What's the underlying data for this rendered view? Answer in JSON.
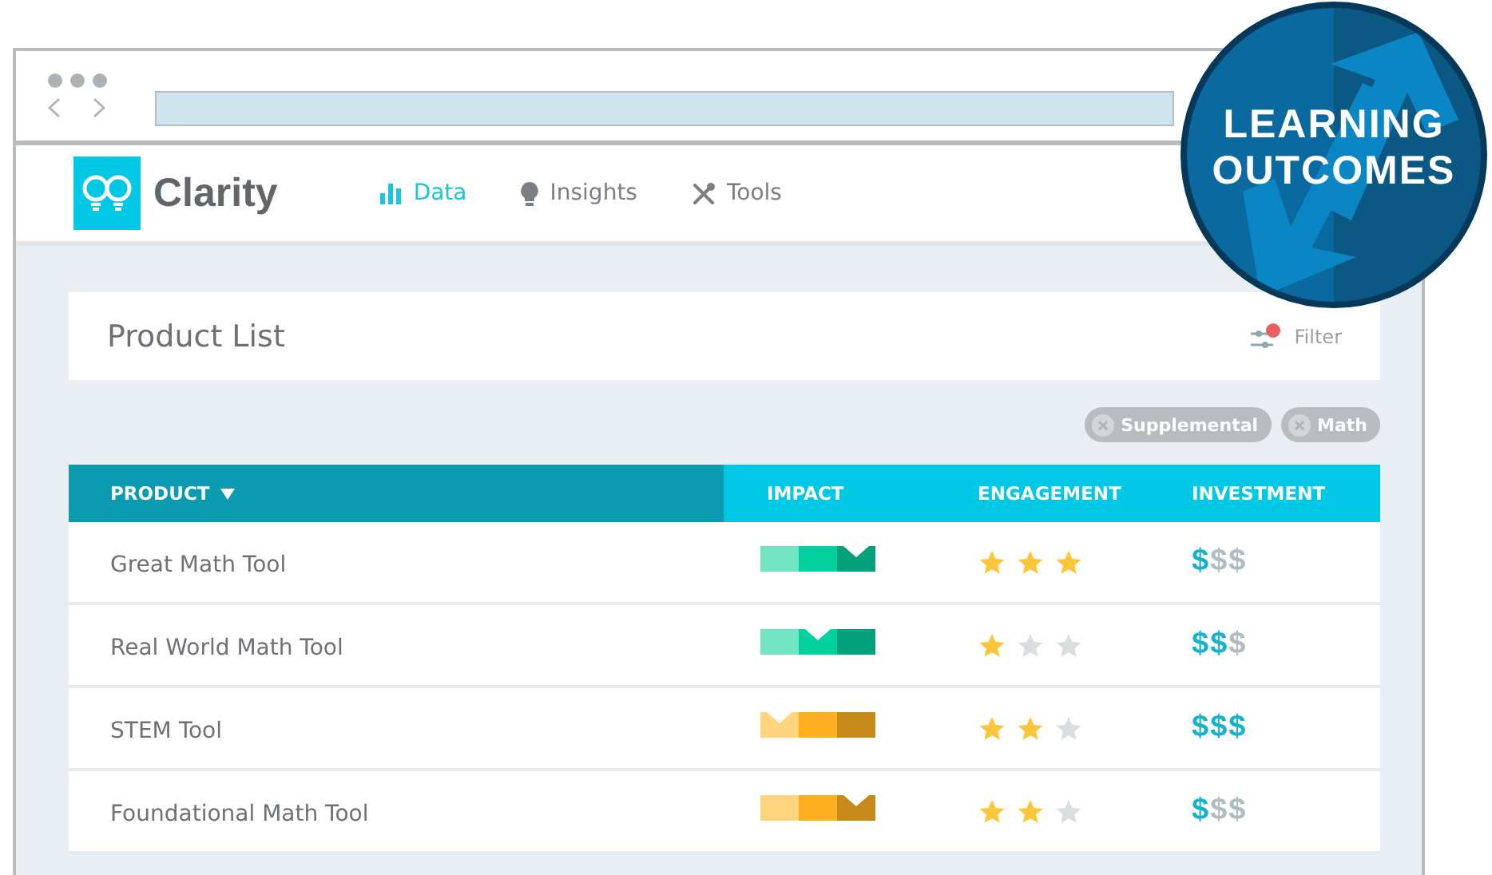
{
  "app": {
    "name": "Clarity"
  },
  "nav": [
    {
      "label": "Data",
      "selected": true
    },
    {
      "label": "Insights",
      "selected": false
    },
    {
      "label": "Tools",
      "selected": false
    }
  ],
  "panel": {
    "title": "Product List",
    "filter": {
      "label": "Filter",
      "active": true
    }
  },
  "chips": [
    {
      "label": "Supplemental"
    },
    {
      "label": "Math"
    }
  ],
  "table": {
    "columns": [
      {
        "label": "PRODUCT",
        "sorted": true
      },
      {
        "label": "IMPACT",
        "sorted": false
      },
      {
        "label": "ENGAGEMENT",
        "sorted": false
      },
      {
        "label": "INVESTMENT",
        "sorted": false
      }
    ],
    "rows": [
      {
        "product": "Great Math Tool",
        "impact": {
          "color": "#00cf9e",
          "kind": "high"
        },
        "stars": 3,
        "investment": [
          {
            "symbol": "$",
            "on": true
          },
          {
            "symbol": "$",
            "on": false
          },
          {
            "symbol": "$",
            "on": false
          }
        ]
      },
      {
        "product": "Real World Math Tool",
        "impact": {
          "color": "#00cf9e",
          "kind": "medium"
        },
        "stars": 1,
        "investment": [
          {
            "symbol": "$",
            "on": true
          },
          {
            "symbol": "$",
            "on": true
          },
          {
            "symbol": "$",
            "on": false
          }
        ]
      },
      {
        "product": "STEM Tool",
        "impact": {
          "color": "#ffb020",
          "kind": "low"
        },
        "stars": 2,
        "investment": [
          {
            "symbol": "$",
            "on": true
          },
          {
            "symbol": "$",
            "on": true
          },
          {
            "symbol": "$",
            "on": true
          }
        ]
      },
      {
        "product": "Foundational Math Tool",
        "impact": {
          "color": "#ffb020",
          "kind": "high"
        },
        "stars": 2,
        "investment": [
          {
            "symbol": "$",
            "on": true
          },
          {
            "symbol": "$",
            "on": false
          },
          {
            "symbol": "$",
            "on": false
          }
        ]
      }
    ]
  },
  "badge": {
    "lines": [
      "LEARNING",
      "OUTCOMES"
    ]
  }
}
